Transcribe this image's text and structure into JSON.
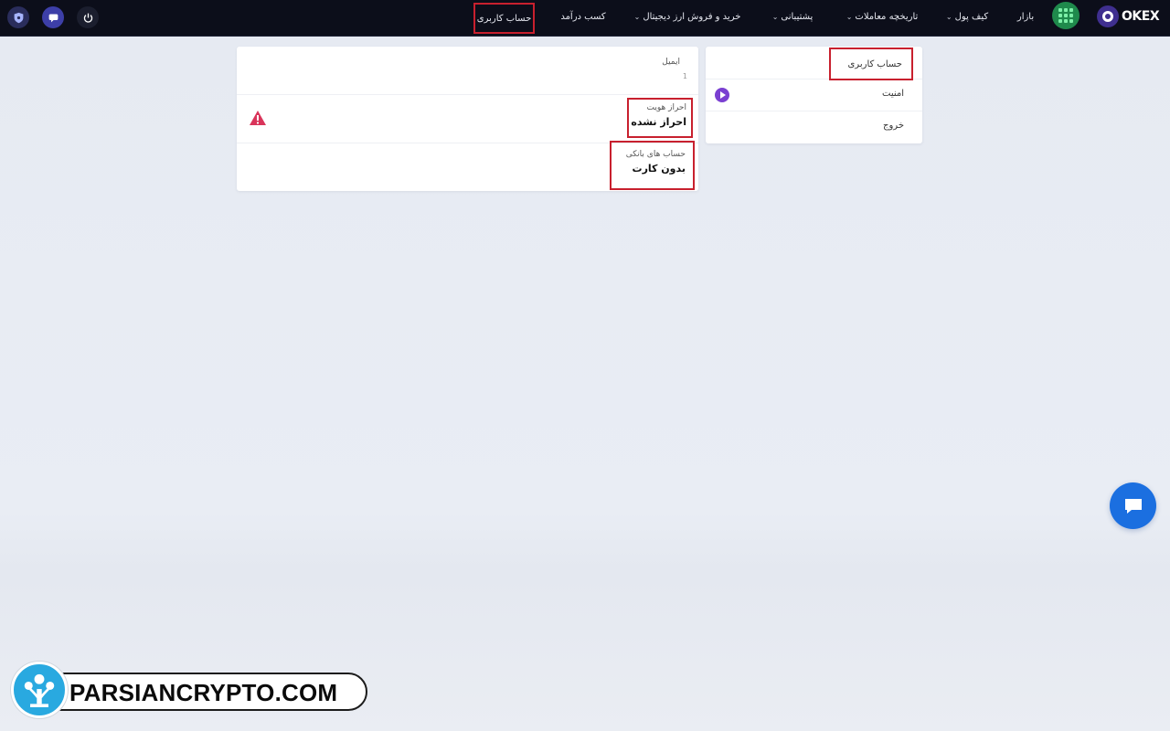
{
  "nav": {
    "account": "حساب کاربری",
    "earn": "کسب درآمد",
    "buy_sell": "خرید و فروش ارز دیجیتال",
    "support": "پشتیبانی",
    "history": "تاریخچه معاملات",
    "wallet": "کیف پول",
    "market": "بازار",
    "brand": "OKEX"
  },
  "menu": {
    "account": "حساب کاربری",
    "security": "امنیت",
    "exit": "خروج"
  },
  "info": {
    "email_label": "ایمیل",
    "email_value": "1",
    "kyc_label": "احراز هویت",
    "kyc_value": "احراز نشده",
    "bank_label": "حساب های بانکی",
    "bank_value": "بدون کارت"
  },
  "watermark": {
    "text": "PARSIANCRYPTO.COM"
  },
  "colors": {
    "navbar": "#0c0e1a",
    "highlight": "#c8202e",
    "accent_purple": "#7a3fd1",
    "chat_blue": "#1b6fe0",
    "warning": "#d9345a"
  }
}
